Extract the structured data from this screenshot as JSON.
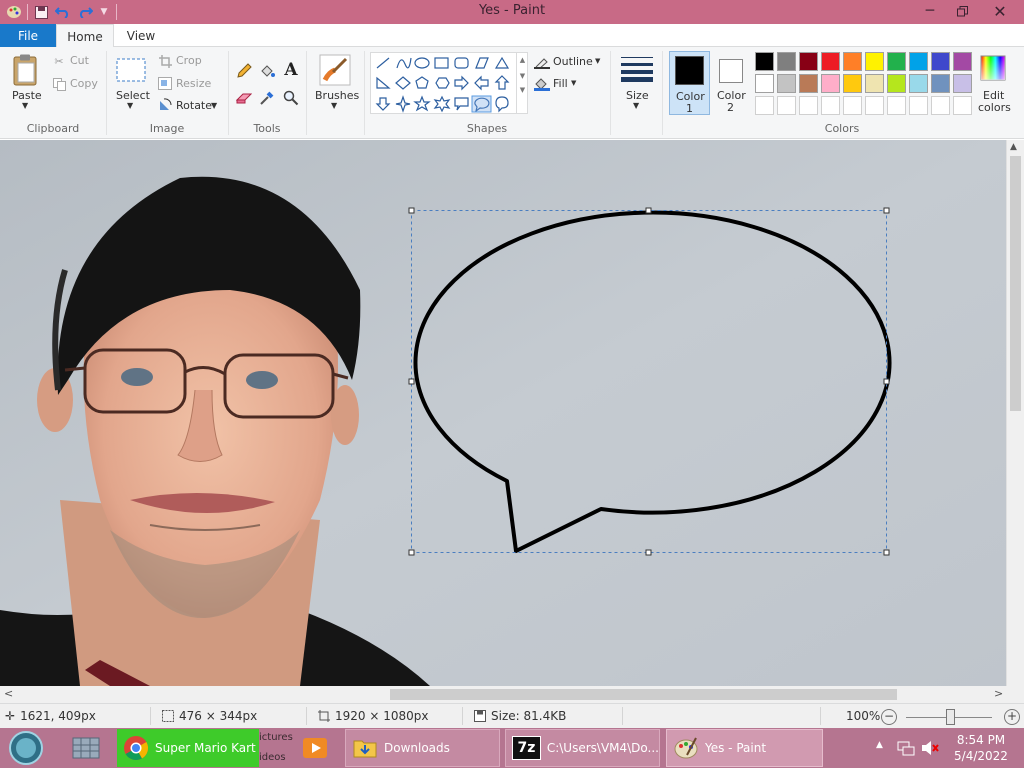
{
  "window": {
    "title": "Yes - Paint"
  },
  "tabs": {
    "file": "File",
    "home": "Home",
    "view": "View"
  },
  "clipboard": {
    "paste": "Paste",
    "cut": "Cut",
    "copy": "Copy",
    "group": "Clipboard"
  },
  "image": {
    "select": "Select",
    "crop": "Crop",
    "resize": "Resize",
    "rotate": "Rotate",
    "group": "Image"
  },
  "tools": {
    "group": "Tools"
  },
  "brushes": {
    "label": "Brushes"
  },
  "shapes": {
    "group": "Shapes",
    "outline": "Outline",
    "fill": "Fill"
  },
  "size": {
    "label": "Size"
  },
  "colors": {
    "color1_a": "Color",
    "color1_b": "1",
    "color2_a": "Color",
    "color2_b": "2",
    "edit_a": "Edit",
    "edit_b": "colors",
    "group": "Colors",
    "row1": [
      "#000000",
      "#7f7f7f",
      "#880015",
      "#ed1c24",
      "#ff7f27",
      "#fff200",
      "#22b14c",
      "#00a2e8",
      "#3f48cc",
      "#a349a4"
    ],
    "row2": [
      "#ffffff",
      "#c3c3c3",
      "#b97a57",
      "#ffaec9",
      "#ffc90e",
      "#efe4b0",
      "#b5e61d",
      "#99d9ea",
      "#7092be",
      "#c8bfe7"
    ],
    "color1": "#000000",
    "color2": "#ffffff"
  },
  "status": {
    "cursor": "1621, 409px",
    "selection": "476 × 344px",
    "image_size": "1920 × 1080px",
    "file_size": "Size: 81.4KB",
    "zoom": "100%"
  },
  "taskbar": {
    "chrome": "Super Mario Kart",
    "behind_text_a": "ictures",
    "behind_text_b": "ideos",
    "downloads": "Downloads",
    "sevenzip": "C:\\Users\\VM4\\Do...",
    "paint": "Yes - Paint",
    "sevenzip_logo": "7z",
    "time": "8:54 PM",
    "date": "5/4/2022"
  }
}
